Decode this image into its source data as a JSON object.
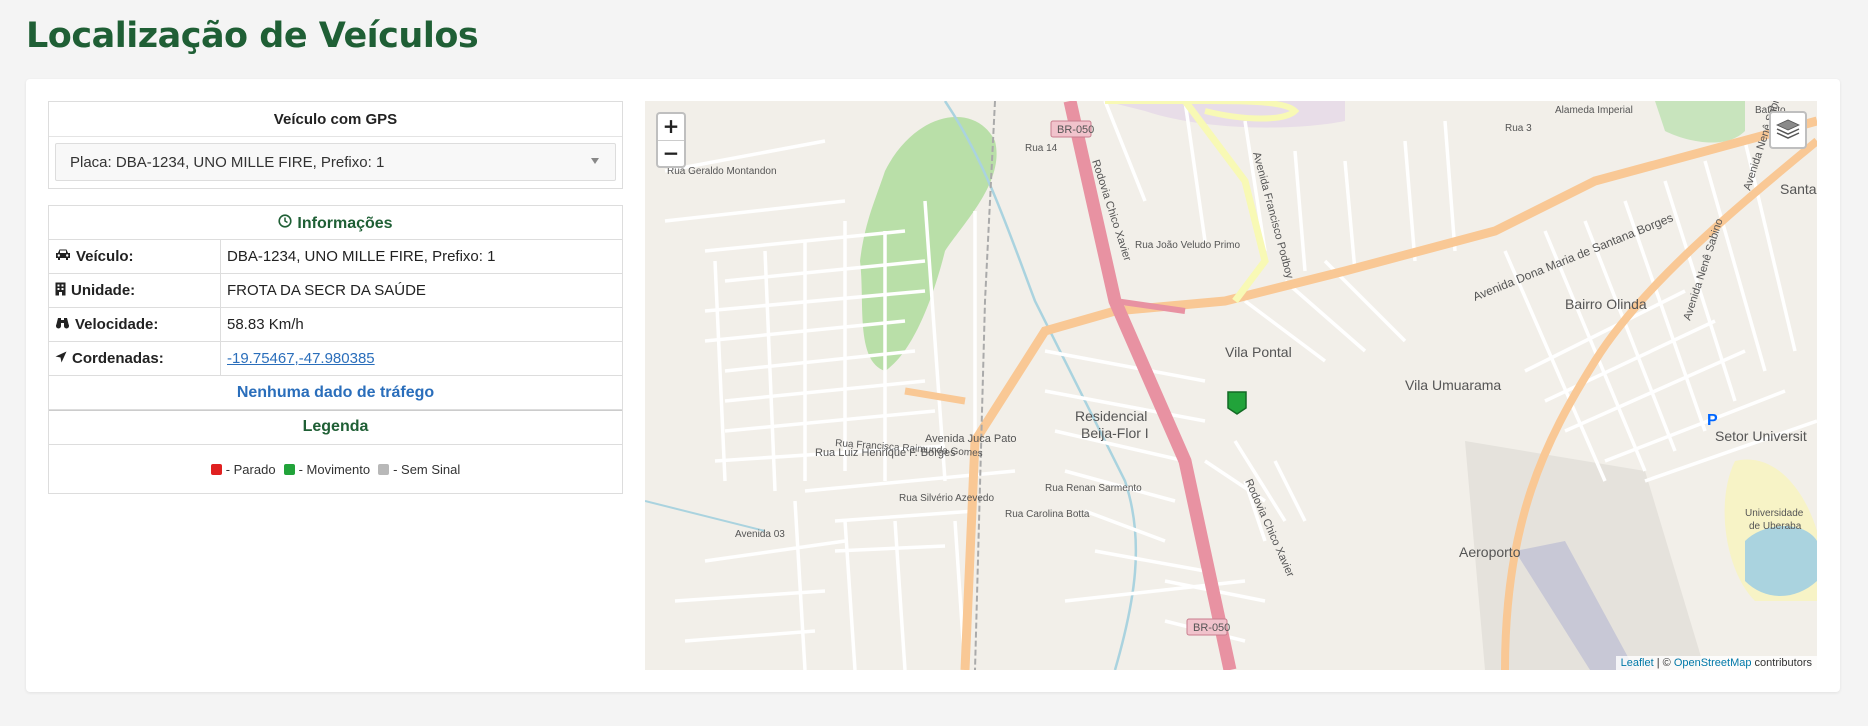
{
  "page": {
    "title": "Localização de Veículos"
  },
  "vehicle_select": {
    "header": "Veículo com GPS",
    "selected": "Placa: DBA-1234, UNO MILLE FIRE, Prefixo: 1"
  },
  "info": {
    "header": "Informações",
    "rows": [
      {
        "label": "Veículo:",
        "value": "DBA-1234, UNO MILLE FIRE, Prefixo: 1",
        "icon": "car-icon"
      },
      {
        "label": "Unidade:",
        "value": "FROTA DA SECR DA SAÚDE",
        "icon": "building-icon"
      },
      {
        "label": "Velocidade:",
        "value": "58.83 Km/h",
        "icon": "binoculars-icon"
      },
      {
        "label": "Cordenadas:",
        "value": "-19.75467,-47.980385",
        "icon": "location-arrow-icon"
      }
    ],
    "traffic": "Nenhuma dado de tráfego"
  },
  "legend": {
    "header": "Legenda",
    "items": [
      {
        "label": "- Parado",
        "color": "#e02020"
      },
      {
        "label": "- Movimento",
        "color": "#21a33a"
      },
      {
        "label": "- Sem Sinal",
        "color": "#b8b8b8"
      }
    ]
  },
  "map": {
    "zoom_in": "+",
    "zoom_out": "−",
    "attribution": {
      "leaflet": "Leaflet",
      "sep": " | © ",
      "osm": "OpenStreetMap",
      "suffix": " contributors"
    },
    "labels": {
      "br050_a": "BR-050",
      "br050_b": "BR-050",
      "chico_a": "Rodovia Chico Xavier",
      "chico_b": "Rodovia Chico Xavier",
      "francisco": "Avenida Francisco Podboy",
      "dona_maria": "Avenida Dona Maria de Santana Borges",
      "vila_pontal": "Vila Pontal",
      "vila_umuarama": "Vila Umuarama",
      "bairro_olinda": "Bairro Olinda",
      "residencial": "Residencial",
      "beija_flor": "Beija-Flor I",
      "setor_univ": "Setor Universit",
      "aeroporto": "Aeroporto",
      "juca_pato": "Avenida Juca Pato",
      "luiz_henrique": "Rua Luiz Henrique F. Borges",
      "nene_sabino_a": "Avenida Nenê Sabino",
      "nene_sabino_b": "Avenida Nenê Sabino",
      "uniube_a": "Universidade",
      "uniube_b": "de Uberaba",
      "joao_veludo": "Rua João Veludo Primo",
      "santa": "Santa",
      "renan": "Rua Renan Sarmento",
      "carolina": "Rua Carolina Botta",
      "silverio": "Rua Silvério Azevedo",
      "geraldo": "Rua Geraldo Montandon",
      "raimunda": "Rua Francisca Raimunda Gomes",
      "av03": "Avenida 03",
      "batisto": "Batisto",
      "alameda": "Alameda Imperial",
      "parking": "P",
      "rua14": "Rua 14",
      "rua3": "Rua 3"
    }
  }
}
